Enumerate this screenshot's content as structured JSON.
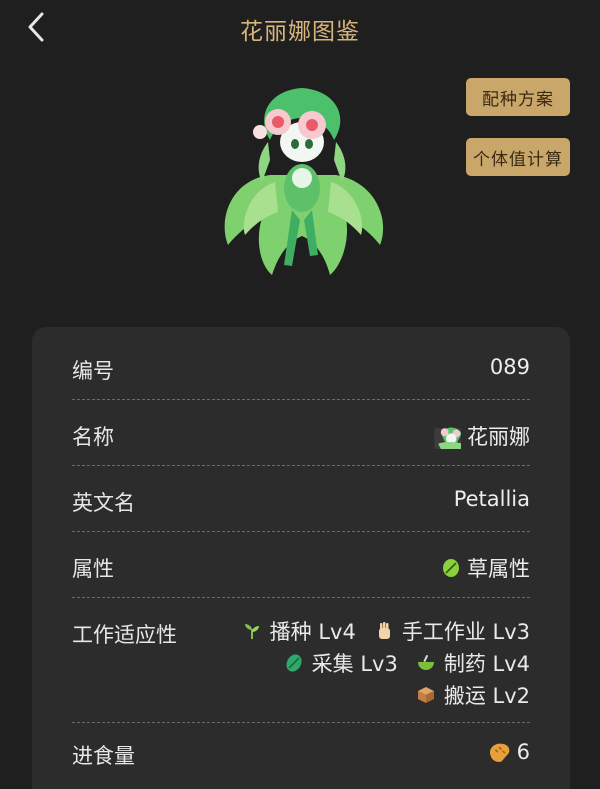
{
  "header": {
    "title": "花丽娜图鉴"
  },
  "buttons": {
    "breeding": "配种方案",
    "iv_calc": "个体值计算"
  },
  "details": {
    "number": {
      "label": "编号",
      "value": "089"
    },
    "name": {
      "label": "名称",
      "value": "花丽娜",
      "icon": "pal-mini-icon"
    },
    "english": {
      "label": "英文名",
      "value": "Petallia"
    },
    "element": {
      "label": "属性",
      "value": "草属性",
      "icon": "leaf-icon"
    },
    "work": {
      "label": "工作适应性",
      "items": [
        {
          "icon": "sprout-icon",
          "text": "播种 Lv4"
        },
        {
          "icon": "hand-icon",
          "text": "手工作业 Lv3"
        },
        {
          "icon": "harvest-icon",
          "text": "采集 Lv3"
        },
        {
          "icon": "medicine-icon",
          "text": "制药 Lv4"
        },
        {
          "icon": "box-icon",
          "text": "搬运 Lv2"
        }
      ]
    },
    "food": {
      "label": "进食量",
      "value": "6",
      "icon": "bread-icon"
    }
  }
}
